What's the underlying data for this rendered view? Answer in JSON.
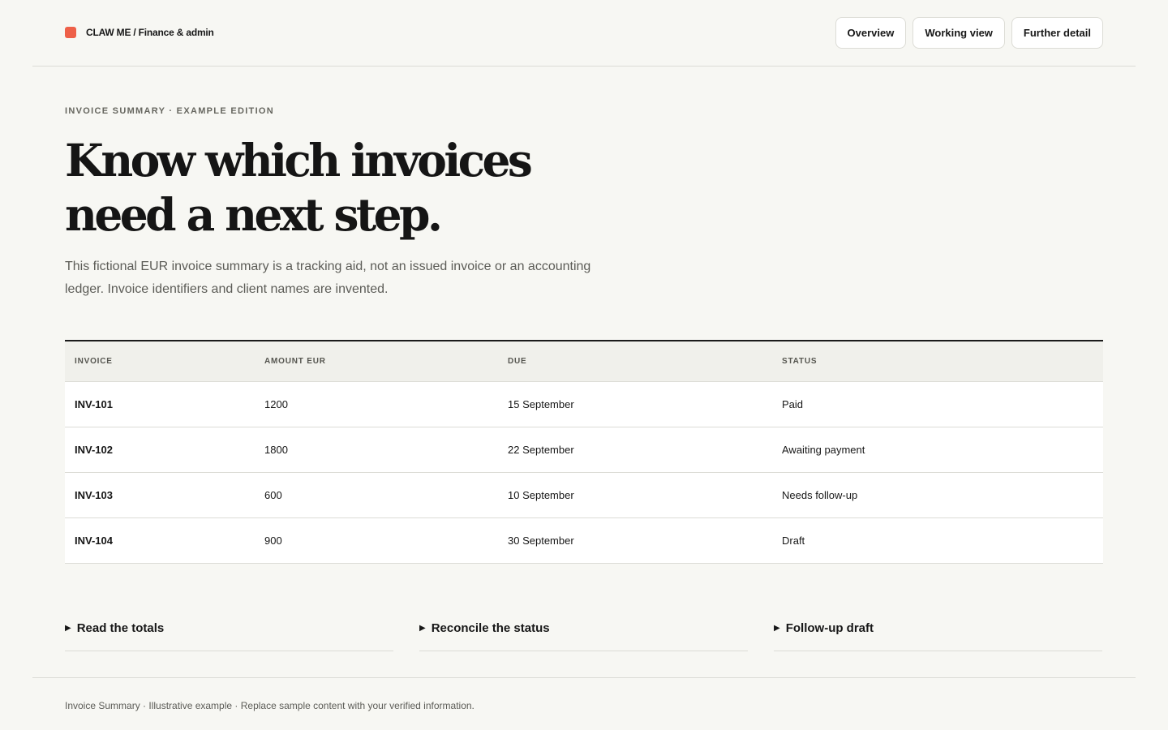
{
  "brand": {
    "name": "CLAW ME / Finance & admin",
    "accent": "#ee6048"
  },
  "nav": {
    "items": [
      {
        "label": "Overview"
      },
      {
        "label": "Working view"
      },
      {
        "label": "Further detail"
      }
    ]
  },
  "hero": {
    "eyebrow": "INVOICE SUMMARY · EXAMPLE EDITION",
    "headline_line_1": "Know which invoices",
    "headline_line_2": "need a next step.",
    "intro": "This fictional EUR invoice summary is a tracking aid, not an issued invoice or an accounting ledger. Invoice identifiers and client names are invented."
  },
  "table": {
    "headers": [
      "INVOICE",
      "AMOUNT EUR",
      "DUE",
      "STATUS"
    ],
    "rows": [
      [
        "INV-101",
        "1200",
        "15 September",
        "Paid"
      ],
      [
        "INV-102",
        "1800",
        "22 September",
        "Awaiting payment"
      ],
      [
        "INV-103",
        "600",
        "10 September",
        "Needs follow-up"
      ],
      [
        "INV-104",
        "900",
        "30 September",
        "Draft"
      ]
    ]
  },
  "details": [
    {
      "icon": "triangle-right-icon",
      "label": "Read the totals"
    },
    {
      "icon": "triangle-right-icon",
      "label": "Reconcile the status"
    },
    {
      "icon": "triangle-right-icon",
      "label": "Follow-up draft"
    }
  ],
  "footer": {
    "text": "Invoice Summary · Illustrative example · Replace sample content with your verified information."
  }
}
